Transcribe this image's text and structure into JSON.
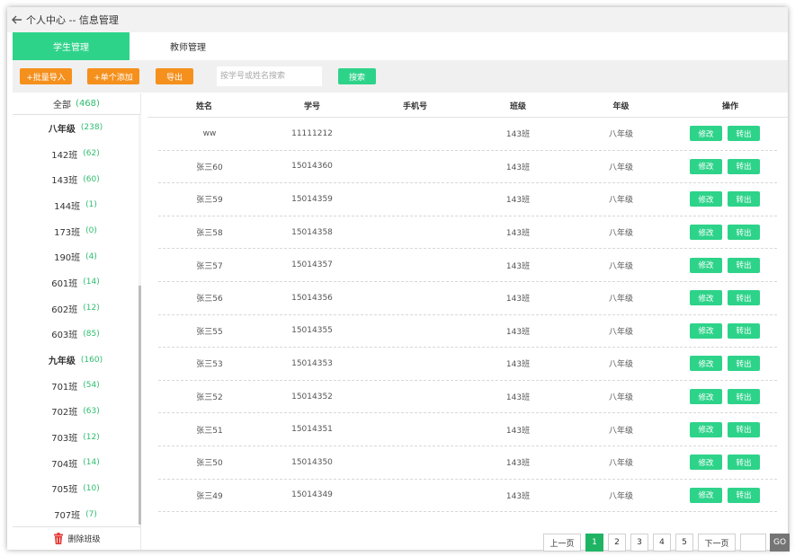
{
  "topbar": {
    "title": "个人中心 -- 信息管理"
  },
  "tabs": [
    {
      "label": "学生管理"
    },
    {
      "label": "教师管理"
    }
  ],
  "toolbar": {
    "import_label": "+批量导入",
    "add_label": "+单个添加",
    "export_label": "导出",
    "search_placeholder": "按学号或姓名搜索",
    "search_label": "搜索"
  },
  "sidebar": {
    "all_label": "全部",
    "all_count": "(468)",
    "items": [
      {
        "label": "八年级",
        "count": "(238)",
        "grade": true
      },
      {
        "label": "142班",
        "count": "(62)"
      },
      {
        "label": "143班",
        "count": "(60)"
      },
      {
        "label": "144班",
        "count": "(1)"
      },
      {
        "label": "173班",
        "count": "(0)"
      },
      {
        "label": "190班",
        "count": "(4)"
      },
      {
        "label": "601班",
        "count": "(14)"
      },
      {
        "label": "602班",
        "count": "(12)"
      },
      {
        "label": "603班",
        "count": "(85)"
      },
      {
        "label": "九年级",
        "count": "(160)",
        "grade": true
      },
      {
        "label": "701班",
        "count": "(54)"
      },
      {
        "label": "702班",
        "count": "(63)"
      },
      {
        "label": "703班",
        "count": "(12)"
      },
      {
        "label": "704班",
        "count": "(14)"
      },
      {
        "label": "705班",
        "count": "(10)"
      },
      {
        "label": "707班",
        "count": "(7)"
      }
    ],
    "delete_label": "删除班级"
  },
  "table": {
    "headers": [
      "姓名",
      "学号",
      "手机号",
      "班级",
      "年级",
      "操作"
    ],
    "edit_label": "修改",
    "transfer_label": "转出",
    "rows": [
      [
        "ww",
        "11111212",
        "",
        "143班",
        "八年级"
      ],
      [
        "张三60",
        "15014360",
        "",
        "143班",
        "八年级"
      ],
      [
        "张三59",
        "15014359",
        "",
        "143班",
        "八年级"
      ],
      [
        "张三58",
        "15014358",
        "",
        "143班",
        "八年级"
      ],
      [
        "张三57",
        "15014357",
        "",
        "143班",
        "八年级"
      ],
      [
        "张三56",
        "15014356",
        "",
        "143班",
        "八年级"
      ],
      [
        "张三55",
        "15014355",
        "",
        "143班",
        "八年级"
      ],
      [
        "张三53",
        "15014353",
        "",
        "143班",
        "八年级"
      ],
      [
        "张三52",
        "15014352",
        "",
        "143班",
        "八年级"
      ],
      [
        "张三51",
        "15014351",
        "",
        "143班",
        "八年级"
      ],
      [
        "张三50",
        "15014350",
        "",
        "143班",
        "八年级"
      ],
      [
        "张三49",
        "15014349",
        "",
        "143班",
        "八年级"
      ]
    ]
  },
  "pagination": {
    "prev_label": "上一页",
    "pages": [
      "1",
      "2",
      "3",
      "4",
      "5"
    ],
    "current": "1",
    "next_label": "下一页",
    "go_label": "GO"
  },
  "colors": {
    "accent": "#2ed38a",
    "orange": "#f5901d",
    "count": "#2ebd6f",
    "page_active": "#1eb464"
  }
}
